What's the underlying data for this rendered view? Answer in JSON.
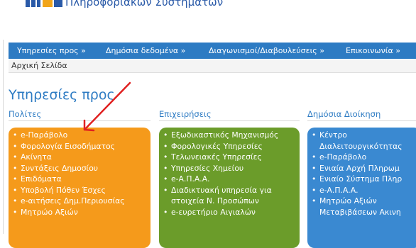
{
  "header": {
    "org_subtitle": "Πληροφοριακών Συστημάτων"
  },
  "nav": {
    "items": [
      "Υπηρεσίες προς »",
      "Δημόσια δεδομένα »",
      "Διαγωνισμοί/Διαβουλεύσεις »",
      "Επικοινωνία »"
    ]
  },
  "breadcrumb": "Αρχική Σελίδα",
  "main": {
    "title": "Υπηρεσίες προς",
    "columns": [
      {
        "title": "Πολίτες",
        "color": "#f59a1b",
        "items": [
          "e-Παράβολο",
          "Φορολογία Εισοδήματος",
          "Ακίνητα",
          "Συντάξεις Δημοσίου",
          "Επιδόματα",
          "Υποβολή Πόθεν Έσχες",
          "e-αιτήσεις Δημ.Περιουσίας",
          "Μητρώο Αξιών"
        ]
      },
      {
        "title": "Επιχειρήσεις",
        "color": "#6b9c2a",
        "items": [
          "Εξωδικαστικός Μηχανισμός",
          "Φορολογικές Υπηρεσίες",
          "Τελωνειακές Υπηρεσίες",
          "Υπηρεσίες Χημείου",
          "e-Α.Π.Α.Α.",
          "Διαδικτυακή υπηρεσία για",
          "στοιχεία Ν. Προσώπων",
          "e-ευρετήριο Αιγιαλών"
        ]
      },
      {
        "title": "Δημόσια Διοίκηση",
        "color": "#3a89d1",
        "items": [
          "Κέντρο",
          "Διαλειτουργικότητας",
          "e-Παράβολο",
          "Ενιαία Αρχή Πληρωμ",
          "Ενιαίο Σύστημα Πληρ",
          "e-Α.Π.Α.Α.",
          "Μητρώο Αξιών",
          "Μεταβιβάσεων Ακινη"
        ]
      }
    ]
  },
  "colors": {
    "nav": "#2d7bc3",
    "title": "#2d7bc3",
    "annotation_arrow": "#e02020"
  }
}
